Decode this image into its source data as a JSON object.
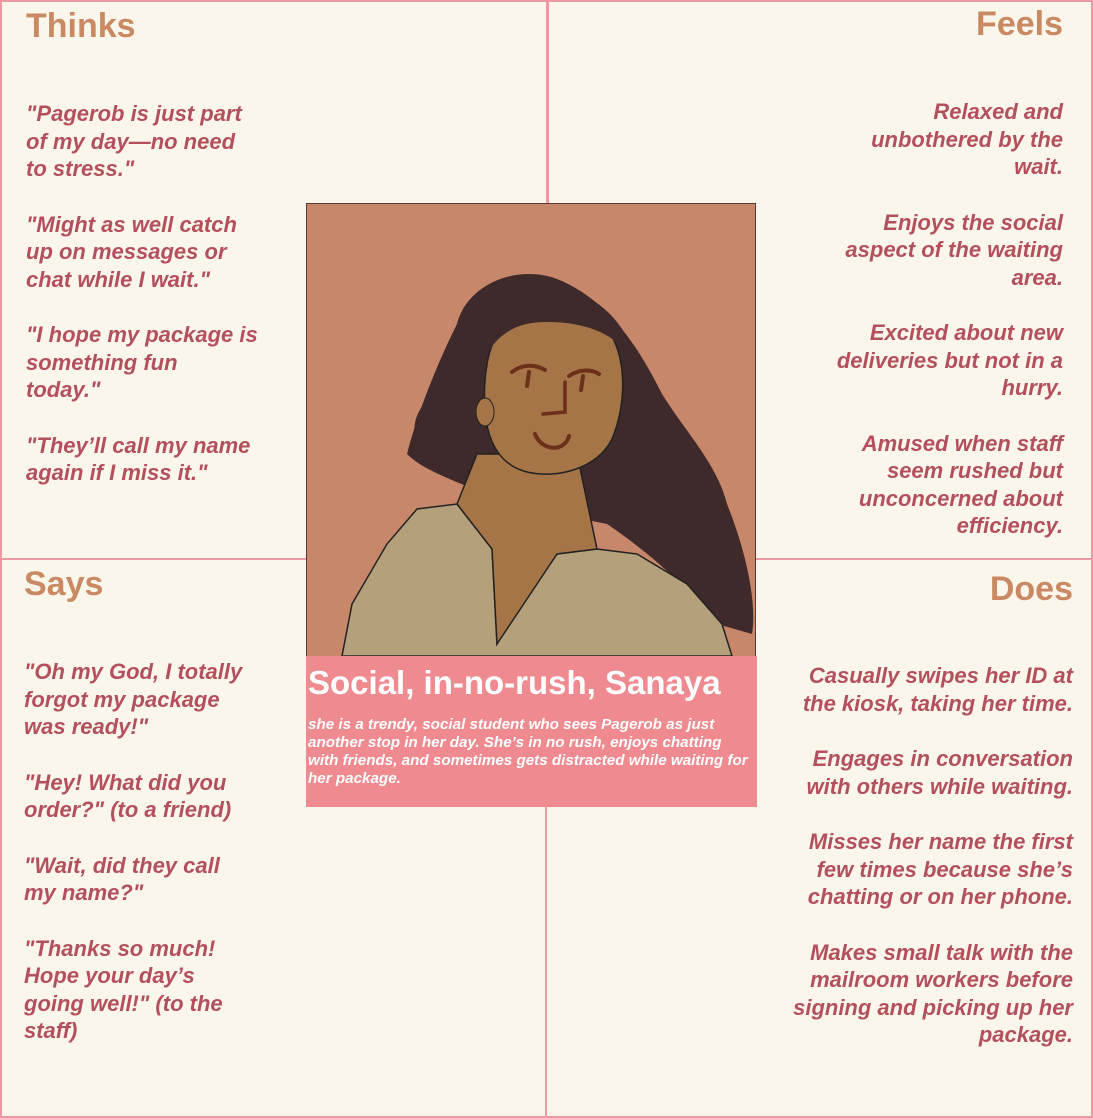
{
  "thinks": {
    "title": "Thinks",
    "items": [
      "\"Pagerob is just part of my day—no need to stress.\"",
      "\"Might as well catch up on messages or chat while I wait.\"",
      "\"I hope my package is something fun today.\"",
      "\"They’ll call my name again if I miss it.\""
    ]
  },
  "feels": {
    "title": "Feels",
    "items": [
      "Relaxed and unbothered by the wait.",
      "Enjoys the social aspect of the waiting area.",
      "Excited about new deliveries but not in a hurry.",
      "Amused when staff seem rushed but unconcerned about efficiency."
    ]
  },
  "says": {
    "title": "Says",
    "items": [
      "\"Oh my God, I totally forgot my package was ready!\"",
      "\"Hey! What did you order?\" (to a friend)",
      "\"Wait, did they call my name?\"",
      "\"Thanks so much! Hope your day’s going well!\" (to the staff)"
    ]
  },
  "does": {
    "title": "Does",
    "items": [
      "Casually swipes her ID at the kiosk, taking her time.",
      "Engages in conversation with others while waiting.",
      "Misses her name the first few times because she’s chatting or on her phone.",
      "Makes small talk with the mailroom workers before signing and picking up her package."
    ]
  },
  "persona": {
    "name": "Social, in-no-rush, Sanaya",
    "description": "she is a trendy, social student who sees Pagerob as just another stop in her day. She’s in no rush, enjoys chatting with friends, and sometimes gets distracted while waiting for her package.",
    "illustration": "portrait-illustration"
  },
  "colors": {
    "background": "#f9f5ea",
    "border": "#ec9aa1",
    "title": "#c98a63",
    "body_text": "#b3505c",
    "card": "#ef8b90",
    "portrait_bg": "#c8876a",
    "skin": "#a57548",
    "hair": "#3f2a2b",
    "shirt": "#b4a07b"
  }
}
